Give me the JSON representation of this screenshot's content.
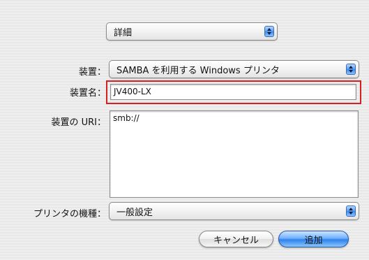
{
  "mode_popup": {
    "value": "詳細"
  },
  "device": {
    "label": "装置：",
    "value": "SAMBA を利用する Windows プリンタ"
  },
  "device_name": {
    "label": "装置名：",
    "value": "JV400-LX"
  },
  "device_uri": {
    "label": "装置の URI：",
    "value": "smb://"
  },
  "printer_model": {
    "label": "プリンタの機種：",
    "value": "一般設定"
  },
  "buttons": {
    "cancel": "キャンセル",
    "add": "追加"
  },
  "colors": {
    "highlight": "#d61f1f",
    "accent": "#3e86e6"
  }
}
